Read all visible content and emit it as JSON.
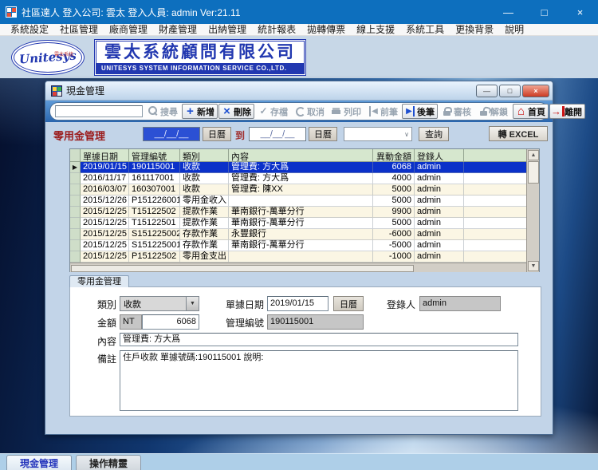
{
  "window": {
    "title": "社區達人  登入公司: 雲太  登入人員: admin Ver:21.11"
  },
  "icons": {
    "minimize": "—",
    "maximize": "□",
    "close": "×",
    "win_minimize": "—",
    "win_maximize": "□",
    "win_close": "×",
    "dropdown": "▼",
    "select_arrow": "∨",
    "marker": "▶",
    "scroll_up": "▲",
    "scroll_down": "▼"
  },
  "menu": {
    "items": [
      "系統設定",
      "社區管理",
      "廠商管理",
      "財產管理",
      "出納管理",
      "統計報表",
      "拋轉傳票",
      "線上支援",
      "系統工具",
      "更換背景",
      "說明"
    ]
  },
  "logo": {
    "badge_text": "Unitesys",
    "badge_sub": "雲太系統",
    "company_zh": "雲太系統顧問有限公司",
    "company_en": "UNITESYS SYSTEM INFORMATION SERVICE CO.,LTD."
  },
  "cash_window": {
    "title": "現金管理",
    "toolbar": {
      "buttons": [
        {
          "label": "搜尋",
          "icon": "search",
          "enabled": false
        },
        {
          "label": "新增",
          "icon": "plus",
          "enabled": true
        },
        {
          "label": "刪除",
          "icon": "cross",
          "enabled": true
        },
        {
          "label": "存檔",
          "icon": "check",
          "enabled": false
        },
        {
          "label": "取消",
          "icon": "undo",
          "enabled": false
        },
        {
          "label": "列印",
          "icon": "print",
          "enabled": false
        },
        {
          "label": "前筆",
          "icon": "prev",
          "enabled": false
        },
        {
          "label": "後筆",
          "icon": "next",
          "enabled": true
        },
        {
          "label": "審核",
          "icon": "lock",
          "enabled": false
        },
        {
          "label": "解鎖",
          "icon": "unlock",
          "enabled": false
        }
      ],
      "home_label": "首頁",
      "exit_label": "離開"
    },
    "filter": {
      "section_title": "零用金管理",
      "date_from": "__/__/__",
      "calendar_label": "日曆",
      "to_label": "到",
      "date_to": "__/__/__",
      "query_label": "查詢",
      "excel_label": "轉 EXCEL"
    },
    "grid": {
      "columns": [
        "單據日期",
        "管理編號",
        "類別",
        "內容",
        "異動金額",
        "登錄人"
      ],
      "rows": [
        {
          "date": "2019/01/15",
          "number": "190115001",
          "type": "收款",
          "content": "管理費: 方大爲",
          "amount": "6068",
          "user": "admin",
          "selected": true
        },
        {
          "date": "2016/11/17",
          "number": "161117001",
          "type": "收款",
          "content": "管理費: 方大爲",
          "amount": "4000",
          "user": "admin",
          "selected": false
        },
        {
          "date": "2016/03/07",
          "number": "160307001",
          "type": "收款",
          "content": "管理費: 陳XX",
          "amount": "5000",
          "user": "admin",
          "selected": false
        },
        {
          "date": "2015/12/26",
          "number": "P151226001",
          "type": "零用金收入",
          "content": "",
          "amount": "5000",
          "user": "admin",
          "selected": false
        },
        {
          "date": "2015/12/25",
          "number": "T15122502",
          "type": "提款作業",
          "content": "華南銀行-萬華分行",
          "amount": "9900",
          "user": "admin",
          "selected": false
        },
        {
          "date": "2015/12/25",
          "number": "T15122501",
          "type": "提款作業",
          "content": "華南銀行-萬華分行",
          "amount": "5000",
          "user": "admin",
          "selected": false
        },
        {
          "date": "2015/12/25",
          "number": "S151225002",
          "type": "存款作業",
          "content": "永豐銀行",
          "amount": "-6000",
          "user": "admin",
          "selected": false
        },
        {
          "date": "2015/12/25",
          "number": "S151225001",
          "type": "存款作業",
          "content": "華南銀行-萬華分行",
          "amount": "-5000",
          "user": "admin",
          "selected": false
        },
        {
          "date": "2015/12/25",
          "number": "P15122502",
          "type": "零用金支出",
          "content": "",
          "amount": "-1000",
          "user": "admin",
          "selected": false
        }
      ]
    },
    "form": {
      "tab_label": "零用金管理",
      "type_label": "類別",
      "type_value": "收款",
      "date_label": "單據日期",
      "date_value": "2019/01/15",
      "calendar_label": "日曆",
      "user_label": "登錄人",
      "user_value": "admin",
      "amount_label": "金額",
      "currency": "NT",
      "amount_value": "6068",
      "number_label": "管理編號",
      "number_value": "190115001",
      "content_label": "內容",
      "content_value": "管理費: 方大爲",
      "note_label": "備註",
      "note_value": "住戶收款 單據號碼:190115001 說明:"
    }
  },
  "taskbar": {
    "items": [
      "現金管理",
      "操作精靈"
    ]
  }
}
